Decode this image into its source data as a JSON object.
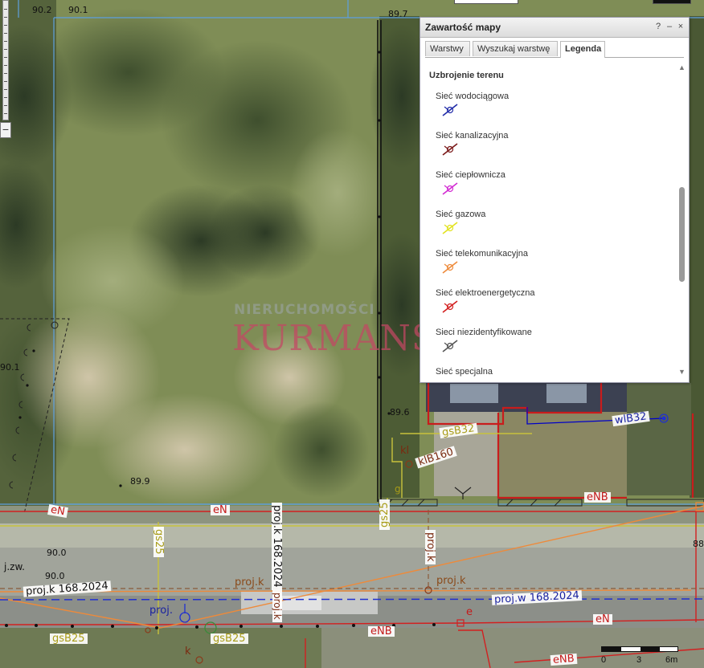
{
  "panel": {
    "title": "Zawartość mapy",
    "help": "?",
    "minimize": "–",
    "close": "×",
    "tabs": [
      "Warstwy",
      "Wyszukaj warstwę",
      "Legenda"
    ],
    "active_tab": "Legenda",
    "legend_heading": "Uzbrojenie terenu",
    "legend_items": [
      {
        "label": "Sieć wodociągowa",
        "color": "#1f2aa8"
      },
      {
        "label": "Sieć kanalizacyjna",
        "color": "#7a1818"
      },
      {
        "label": "Sieć ciepłownicza",
        "color": "#d22ad2"
      },
      {
        "label": "Sieć gazowa",
        "color": "#e2e21e"
      },
      {
        "label": "Sieć telekomunikacyjna",
        "color": "#ee8a3a"
      },
      {
        "label": "Sieć elektroenergetyczna",
        "color": "#d21e1e"
      },
      {
        "label": "Sieci niezidentyfikowane",
        "color": "#555555"
      },
      {
        "label": "Sieć specjalna",
        "color": "#333333"
      }
    ]
  },
  "watermark": {
    "top": "NIERUCHOMOŚCI",
    "main": "KURMANSKA"
  },
  "map": {
    "elevations": [
      "90.2",
      "90.1",
      "89.7",
      "90.1",
      "89.6",
      "89.9",
      "90.0",
      "90.0",
      "88"
    ],
    "labels": {
      "eN_left": "eN",
      "eN_mid": "eN",
      "eNB_right": "eNB",
      "gsB32": "gsB32",
      "kl": "kl",
      "klB160": "klB160",
      "wlB32": "wlB32",
      "gs25_a": "gs25",
      "gs25_b": "gs25",
      "projk_168_vert": "proj.k 168.2024",
      "projk_168_vert2": "proj.k 168.2024",
      "projk_168_h": "proj.k 168.2024",
      "projk_vert": "proj.k",
      "projk_a": "proj.k",
      "projk_b": "proj.k",
      "projk_c": "proj.k",
      "projw_168": "proj.w 168.2024",
      "proj": "proj.",
      "jzw": "j.zw.",
      "gsB25_a": "gsB25",
      "gsB25_b": "gsB25",
      "eNB_bottom": "eNB",
      "eN_bottom": "eN",
      "eNB_bottom2": "eNB",
      "e": "e",
      "k": "k",
      "g": "g"
    },
    "scale": [
      "0",
      "3",
      "6m"
    ]
  }
}
